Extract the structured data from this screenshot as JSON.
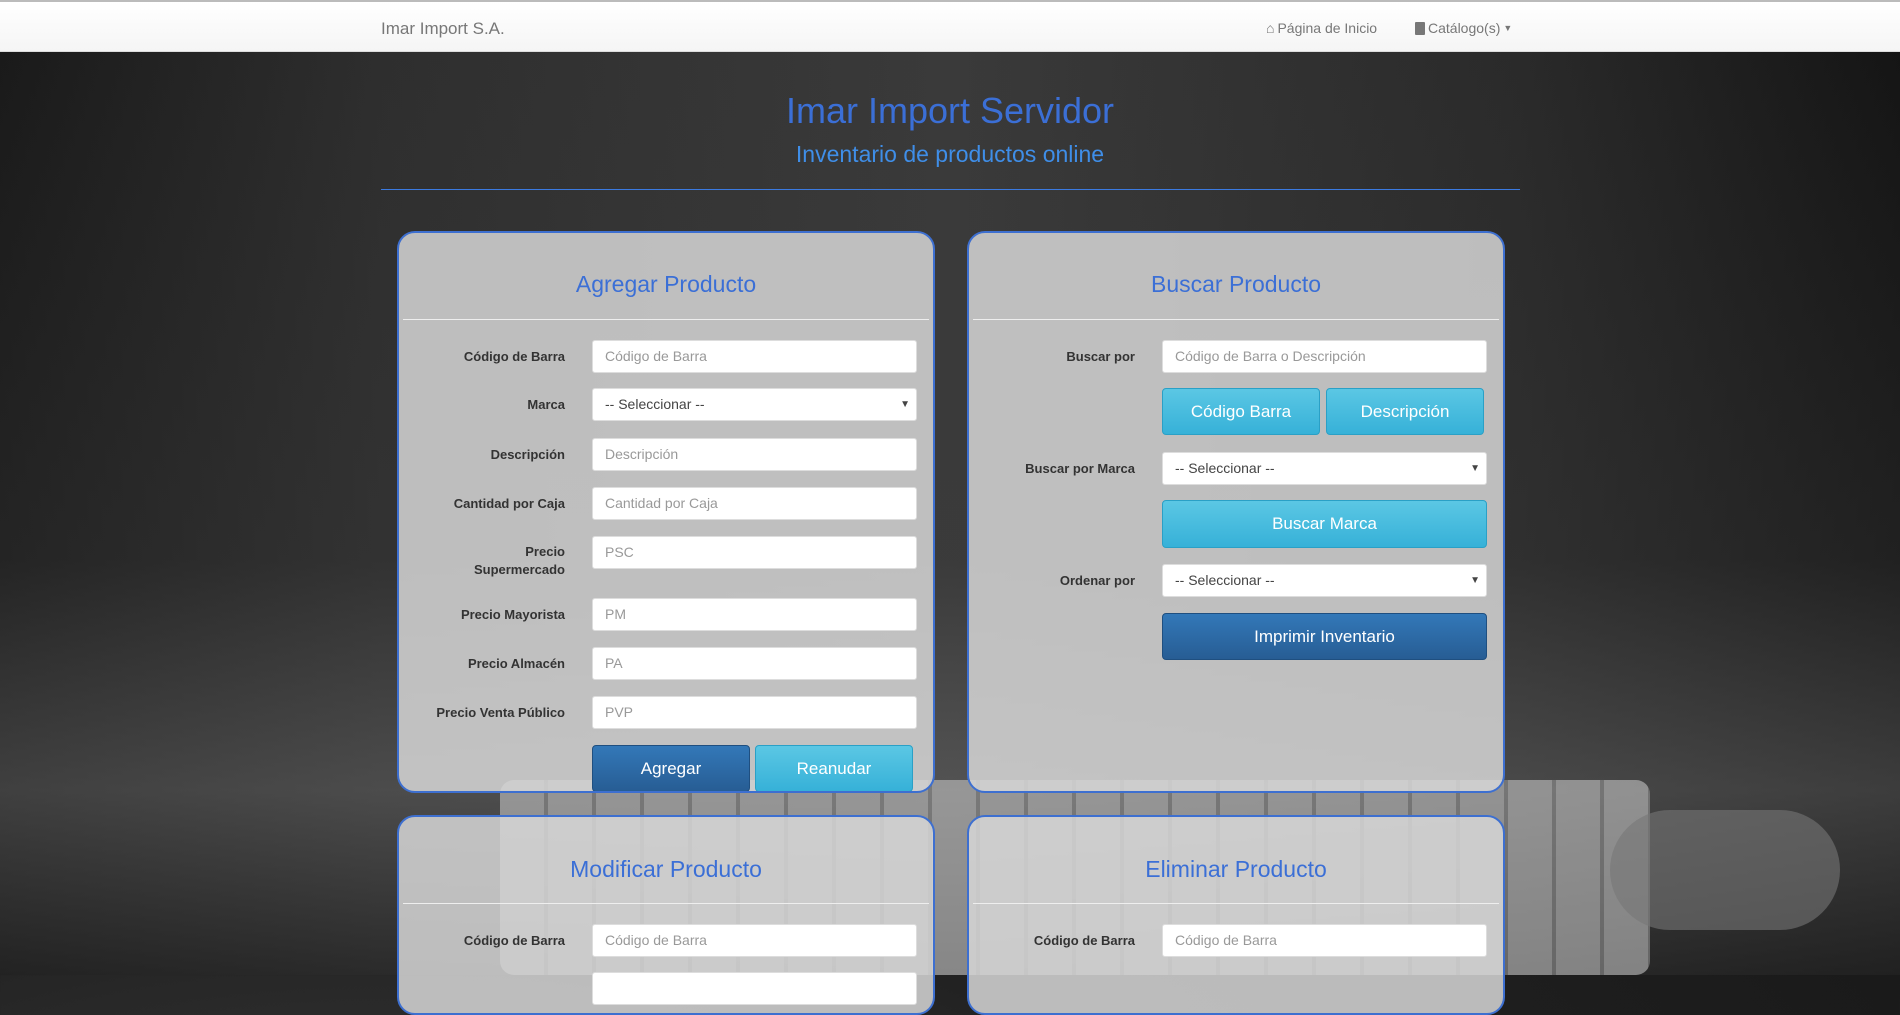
{
  "navbar": {
    "brand": "Imar Import S.A.",
    "home": "Página de Inicio",
    "catalog": "Catálogo(s)"
  },
  "hero": {
    "title": "Imar Import Servidor",
    "subtitle": "Inventario de productos online"
  },
  "add": {
    "title": "Agregar Producto",
    "fields": [
      {
        "label": "Código de Barra",
        "placeholder": "Código de Barra"
      },
      {
        "label": "Marca",
        "value": "-- Seleccionar --"
      },
      {
        "label": "Descripción",
        "placeholder": "Descripción"
      },
      {
        "label": "Cantidad por Caja",
        "placeholder": "Cantidad por Caja"
      },
      {
        "label": "Precio Supermercado",
        "placeholder": "PSC"
      },
      {
        "label": "Precio Mayorista",
        "placeholder": "PM"
      },
      {
        "label": "Precio Almacén",
        "placeholder": "PA"
      },
      {
        "label": "Precio Venta Público",
        "placeholder": "PVP"
      }
    ],
    "add_button": "Agregar",
    "reset_button": "Reanudar"
  },
  "search": {
    "title": "Buscar Producto",
    "search_by_label": "Buscar por",
    "search_placeholder": "Código de Barra o Descripción",
    "barcode_button": "Código Barra",
    "description_button": "Descripción",
    "brand_label": "Buscar por Marca",
    "brand_value": "-- Seleccionar --",
    "brand_button": "Buscar Marca",
    "order_label": "Ordenar por",
    "order_value": "-- Seleccionar --",
    "print_button": "Imprimir Inventario"
  },
  "modify": {
    "title": "Modificar Producto",
    "barcode_label": "Código de Barra",
    "barcode_placeholder": "Código de Barra"
  },
  "delete": {
    "title": "Eliminar Producto",
    "barcode_label": "Código de Barra",
    "barcode_placeholder": "Código de Barra"
  }
}
